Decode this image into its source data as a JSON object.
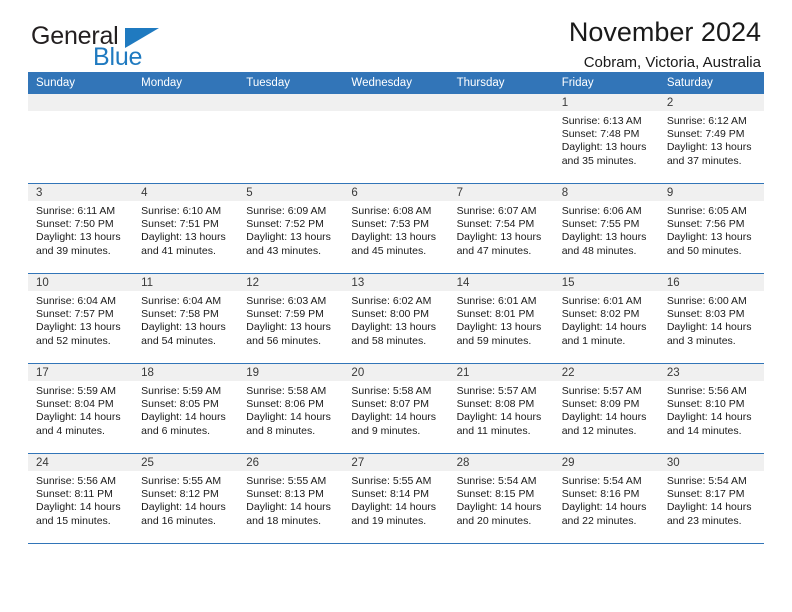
{
  "brand": {
    "name_top": "General",
    "name_bottom": "Blue",
    "accent_color": "#1f7ac0"
  },
  "header": {
    "title": "November 2024",
    "subtitle": "Cobram, Victoria, Australia"
  },
  "colors": {
    "header_blue": "#3275b8",
    "daynum_band": "#f0f0f0",
    "text": "#1a1a1a"
  },
  "weekday_headers": [
    "Sunday",
    "Monday",
    "Tuesday",
    "Wednesday",
    "Thursday",
    "Friday",
    "Saturday"
  ],
  "labels": {
    "sunrise": "Sunrise:",
    "sunset": "Sunset:",
    "daylight": "Daylight:"
  },
  "weeks": [
    [
      {
        "day": "",
        "sunrise": "",
        "sunset": "",
        "daylight1": "",
        "daylight2": ""
      },
      {
        "day": "",
        "sunrise": "",
        "sunset": "",
        "daylight1": "",
        "daylight2": ""
      },
      {
        "day": "",
        "sunrise": "",
        "sunset": "",
        "daylight1": "",
        "daylight2": ""
      },
      {
        "day": "",
        "sunrise": "",
        "sunset": "",
        "daylight1": "",
        "daylight2": ""
      },
      {
        "day": "",
        "sunrise": "",
        "sunset": "",
        "daylight1": "",
        "daylight2": ""
      },
      {
        "day": "1",
        "sunrise": "Sunrise: 6:13 AM",
        "sunset": "Sunset: 7:48 PM",
        "daylight1": "Daylight: 13 hours",
        "daylight2": "and 35 minutes."
      },
      {
        "day": "2",
        "sunrise": "Sunrise: 6:12 AM",
        "sunset": "Sunset: 7:49 PM",
        "daylight1": "Daylight: 13 hours",
        "daylight2": "and 37 minutes."
      }
    ],
    [
      {
        "day": "3",
        "sunrise": "Sunrise: 6:11 AM",
        "sunset": "Sunset: 7:50 PM",
        "daylight1": "Daylight: 13 hours",
        "daylight2": "and 39 minutes."
      },
      {
        "day": "4",
        "sunrise": "Sunrise: 6:10 AM",
        "sunset": "Sunset: 7:51 PM",
        "daylight1": "Daylight: 13 hours",
        "daylight2": "and 41 minutes."
      },
      {
        "day": "5",
        "sunrise": "Sunrise: 6:09 AM",
        "sunset": "Sunset: 7:52 PM",
        "daylight1": "Daylight: 13 hours",
        "daylight2": "and 43 minutes."
      },
      {
        "day": "6",
        "sunrise": "Sunrise: 6:08 AM",
        "sunset": "Sunset: 7:53 PM",
        "daylight1": "Daylight: 13 hours",
        "daylight2": "and 45 minutes."
      },
      {
        "day": "7",
        "sunrise": "Sunrise: 6:07 AM",
        "sunset": "Sunset: 7:54 PM",
        "daylight1": "Daylight: 13 hours",
        "daylight2": "and 47 minutes."
      },
      {
        "day": "8",
        "sunrise": "Sunrise: 6:06 AM",
        "sunset": "Sunset: 7:55 PM",
        "daylight1": "Daylight: 13 hours",
        "daylight2": "and 48 minutes."
      },
      {
        "day": "9",
        "sunrise": "Sunrise: 6:05 AM",
        "sunset": "Sunset: 7:56 PM",
        "daylight1": "Daylight: 13 hours",
        "daylight2": "and 50 minutes."
      }
    ],
    [
      {
        "day": "10",
        "sunrise": "Sunrise: 6:04 AM",
        "sunset": "Sunset: 7:57 PM",
        "daylight1": "Daylight: 13 hours",
        "daylight2": "and 52 minutes."
      },
      {
        "day": "11",
        "sunrise": "Sunrise: 6:04 AM",
        "sunset": "Sunset: 7:58 PM",
        "daylight1": "Daylight: 13 hours",
        "daylight2": "and 54 minutes."
      },
      {
        "day": "12",
        "sunrise": "Sunrise: 6:03 AM",
        "sunset": "Sunset: 7:59 PM",
        "daylight1": "Daylight: 13 hours",
        "daylight2": "and 56 minutes."
      },
      {
        "day": "13",
        "sunrise": "Sunrise: 6:02 AM",
        "sunset": "Sunset: 8:00 PM",
        "daylight1": "Daylight: 13 hours",
        "daylight2": "and 58 minutes."
      },
      {
        "day": "14",
        "sunrise": "Sunrise: 6:01 AM",
        "sunset": "Sunset: 8:01 PM",
        "daylight1": "Daylight: 13 hours",
        "daylight2": "and 59 minutes."
      },
      {
        "day": "15",
        "sunrise": "Sunrise: 6:01 AM",
        "sunset": "Sunset: 8:02 PM",
        "daylight1": "Daylight: 14 hours",
        "daylight2": "and 1 minute."
      },
      {
        "day": "16",
        "sunrise": "Sunrise: 6:00 AM",
        "sunset": "Sunset: 8:03 PM",
        "daylight1": "Daylight: 14 hours",
        "daylight2": "and 3 minutes."
      }
    ],
    [
      {
        "day": "17",
        "sunrise": "Sunrise: 5:59 AM",
        "sunset": "Sunset: 8:04 PM",
        "daylight1": "Daylight: 14 hours",
        "daylight2": "and 4 minutes."
      },
      {
        "day": "18",
        "sunrise": "Sunrise: 5:59 AM",
        "sunset": "Sunset: 8:05 PM",
        "daylight1": "Daylight: 14 hours",
        "daylight2": "and 6 minutes."
      },
      {
        "day": "19",
        "sunrise": "Sunrise: 5:58 AM",
        "sunset": "Sunset: 8:06 PM",
        "daylight1": "Daylight: 14 hours",
        "daylight2": "and 8 minutes."
      },
      {
        "day": "20",
        "sunrise": "Sunrise: 5:58 AM",
        "sunset": "Sunset: 8:07 PM",
        "daylight1": "Daylight: 14 hours",
        "daylight2": "and 9 minutes."
      },
      {
        "day": "21",
        "sunrise": "Sunrise: 5:57 AM",
        "sunset": "Sunset: 8:08 PM",
        "daylight1": "Daylight: 14 hours",
        "daylight2": "and 11 minutes."
      },
      {
        "day": "22",
        "sunrise": "Sunrise: 5:57 AM",
        "sunset": "Sunset: 8:09 PM",
        "daylight1": "Daylight: 14 hours",
        "daylight2": "and 12 minutes."
      },
      {
        "day": "23",
        "sunrise": "Sunrise: 5:56 AM",
        "sunset": "Sunset: 8:10 PM",
        "daylight1": "Daylight: 14 hours",
        "daylight2": "and 14 minutes."
      }
    ],
    [
      {
        "day": "24",
        "sunrise": "Sunrise: 5:56 AM",
        "sunset": "Sunset: 8:11 PM",
        "daylight1": "Daylight: 14 hours",
        "daylight2": "and 15 minutes."
      },
      {
        "day": "25",
        "sunrise": "Sunrise: 5:55 AM",
        "sunset": "Sunset: 8:12 PM",
        "daylight1": "Daylight: 14 hours",
        "daylight2": "and 16 minutes."
      },
      {
        "day": "26",
        "sunrise": "Sunrise: 5:55 AM",
        "sunset": "Sunset: 8:13 PM",
        "daylight1": "Daylight: 14 hours",
        "daylight2": "and 18 minutes."
      },
      {
        "day": "27",
        "sunrise": "Sunrise: 5:55 AM",
        "sunset": "Sunset: 8:14 PM",
        "daylight1": "Daylight: 14 hours",
        "daylight2": "and 19 minutes."
      },
      {
        "day": "28",
        "sunrise": "Sunrise: 5:54 AM",
        "sunset": "Sunset: 8:15 PM",
        "daylight1": "Daylight: 14 hours",
        "daylight2": "and 20 minutes."
      },
      {
        "day": "29",
        "sunrise": "Sunrise: 5:54 AM",
        "sunset": "Sunset: 8:16 PM",
        "daylight1": "Daylight: 14 hours",
        "daylight2": "and 22 minutes."
      },
      {
        "day": "30",
        "sunrise": "Sunrise: 5:54 AM",
        "sunset": "Sunset: 8:17 PM",
        "daylight1": "Daylight: 14 hours",
        "daylight2": "and 23 minutes."
      }
    ]
  ]
}
